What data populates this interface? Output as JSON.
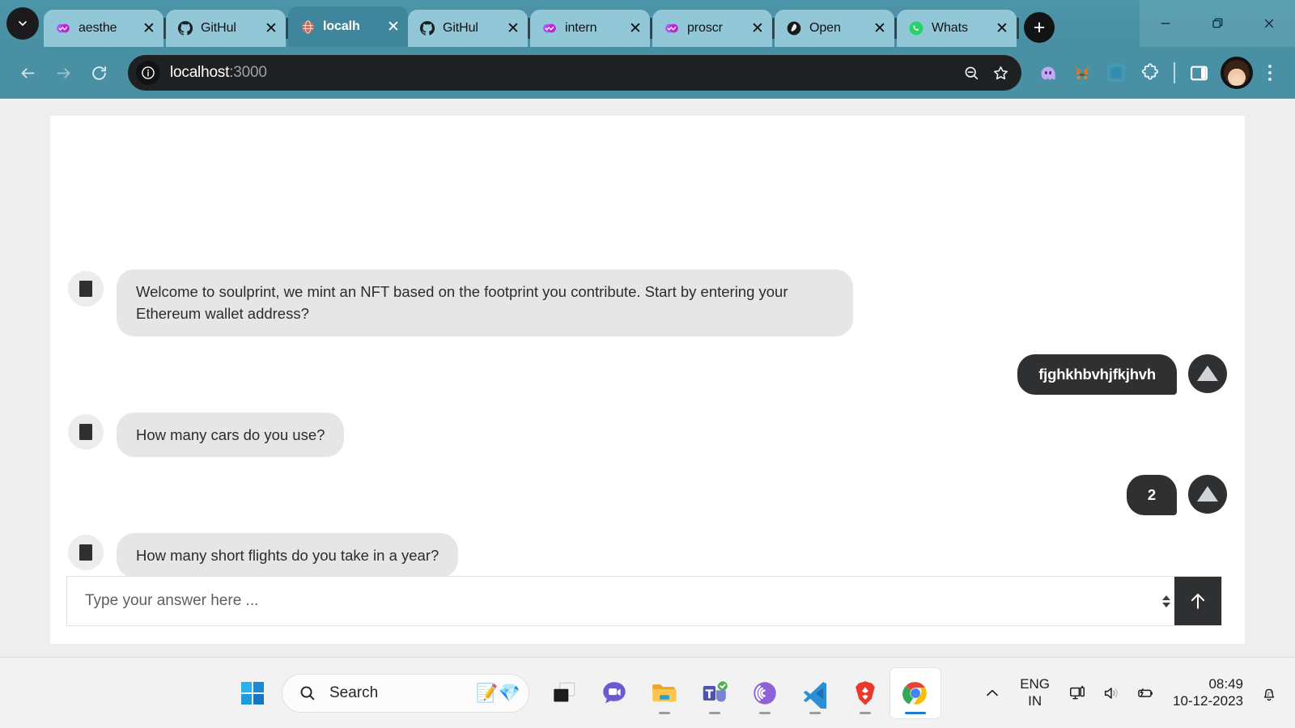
{
  "browser": {
    "tabs": [
      {
        "title": "aesthe",
        "favicon": "double-check-badge-icon",
        "active": false
      },
      {
        "title": "GitHul",
        "favicon": "github-icon",
        "active": false
      },
      {
        "title": "localh",
        "favicon": "globe-icon",
        "active": true
      },
      {
        "title": "GitHul",
        "favicon": "github-icon",
        "active": false
      },
      {
        "title": "intern",
        "favicon": "double-check-badge-icon",
        "active": false
      },
      {
        "title": "proscr",
        "favicon": "double-check-badge-icon",
        "active": false
      },
      {
        "title": "Open",
        "favicon": "openai-icon",
        "active": false
      },
      {
        "title": "Whats",
        "favicon": "whatsapp-icon",
        "active": false
      }
    ],
    "new_tab_label": "+",
    "tab_close_label": "✕",
    "url": {
      "host": "localhost",
      "port": ":3000"
    },
    "window_controls": {
      "minimize": "minimize-icon",
      "restore": "restore-icon",
      "close": "close-icon"
    },
    "extensions": [
      {
        "name": "phantom-wallet-icon"
      },
      {
        "name": "metamask-icon"
      },
      {
        "name": "blue-square-extension-icon"
      },
      {
        "name": "extensions-puzzle-icon"
      }
    ]
  },
  "page": {
    "messages": [
      {
        "role": "bot",
        "text": "Welcome to soulprint, we mint an NFT based on the footprint you contribute. Start by entering your Ethereum wallet address?"
      },
      {
        "role": "user",
        "text": "fjghkhbvhjfkjhvh"
      },
      {
        "role": "bot",
        "text": "How many cars do you use?"
      },
      {
        "role": "user",
        "text": "2"
      },
      {
        "role": "bot",
        "text": "How many short flights do you take in a year?"
      }
    ],
    "composer": {
      "placeholder": "Type your answer here ...",
      "value": "",
      "send_label": "send-arrow-up"
    },
    "colors": {
      "bot_bubble": "#e6e6e6",
      "user_bubble": "#2e3032",
      "send_button": "#2e3032",
      "page_background": "#eeeeee",
      "card_background": "#ffffff"
    }
  },
  "taskbar": {
    "start_label": "start-button",
    "search": {
      "placeholder": "Search"
    },
    "apps": [
      {
        "name": "task-view",
        "running": false
      },
      {
        "name": "chat-video-app",
        "running": false
      },
      {
        "name": "file-explorer",
        "running": true
      },
      {
        "name": "microsoft-teams",
        "running": true
      },
      {
        "name": "bittorrent",
        "running": true
      },
      {
        "name": "vs-code",
        "running": true
      },
      {
        "name": "brave-browser",
        "running": true
      },
      {
        "name": "google-chrome",
        "running": true,
        "active": true
      }
    ],
    "tray": {
      "overflow": "chevron-up-icon",
      "language_primary": "ENG",
      "language_secondary": "IN",
      "network": "network-display-icon",
      "volume": "volume-icon",
      "battery": "battery-charging-icon",
      "time": "08:49",
      "date": "10-12-2023",
      "notifications": "do-not-disturb-bell-icon"
    }
  }
}
